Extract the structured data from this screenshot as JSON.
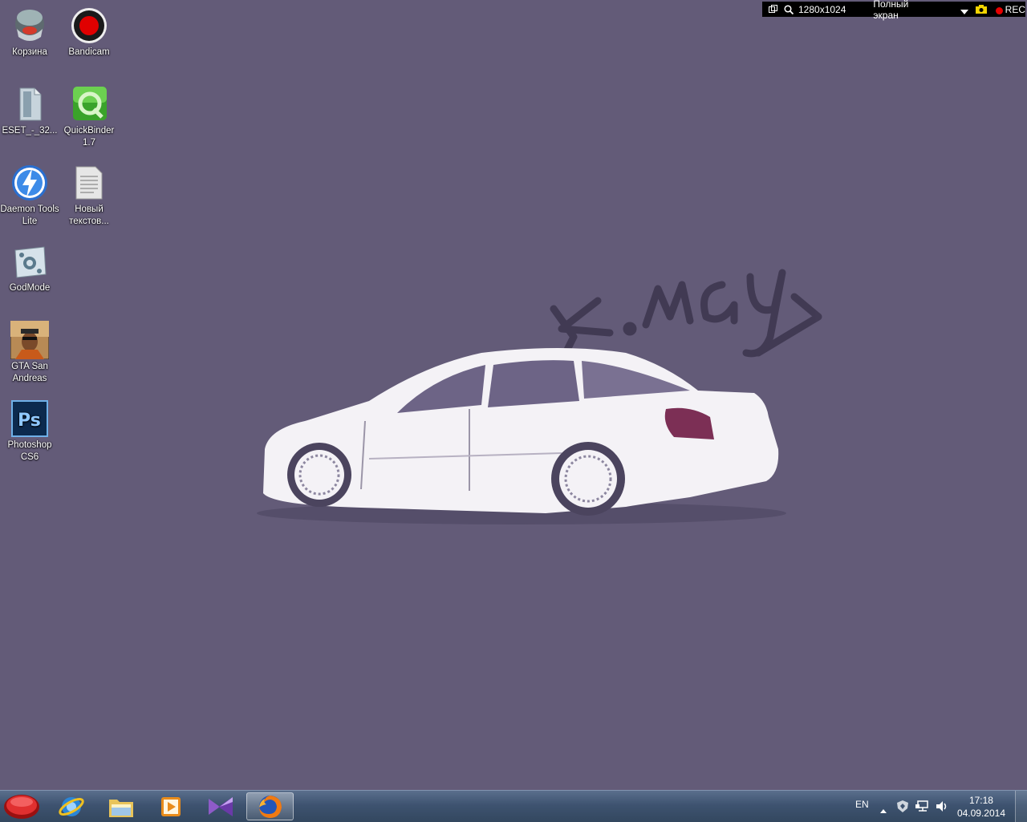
{
  "desktop": {
    "background_color": "#635b78",
    "wallpaper_text": "K.MAY",
    "icons": [
      {
        "label": "Корзина",
        "icon": "recycle-bin-icon"
      },
      {
        "label": "Bandicam",
        "icon": "bandicam-icon"
      },
      {
        "label": "ESET_-_32...",
        "icon": "file-icon"
      },
      {
        "label": "QuickBinder 1.7",
        "icon": "quickbinder-icon"
      },
      {
        "label": "Daemon Tools Lite",
        "icon": "daemon-tools-icon"
      },
      {
        "label": "Новый текстов...",
        "icon": "text-document-icon"
      },
      {
        "label": "GodMode",
        "icon": "godmode-icon"
      },
      {
        "label": "GTA San Andreas",
        "icon": "gta-icon"
      },
      {
        "label": "Photoshop CS6",
        "icon": "photoshop-icon"
      }
    ]
  },
  "recorder": {
    "resolution": "1280x1024",
    "mode": "Полный экран",
    "rec_label": "REC"
  },
  "taskbar": {
    "apps": [
      {
        "name": "start",
        "icon": "start-button-icon"
      },
      {
        "name": "internet-explorer",
        "icon": "ie-icon"
      },
      {
        "name": "explorer",
        "icon": "folder-icon"
      },
      {
        "name": "media-player",
        "icon": "media-player-icon"
      },
      {
        "name": "visual-studio",
        "icon": "visual-studio-icon"
      },
      {
        "name": "firefox",
        "icon": "firefox-icon"
      }
    ],
    "language": "EN",
    "time": "17:18",
    "date": "04.09.2014"
  }
}
